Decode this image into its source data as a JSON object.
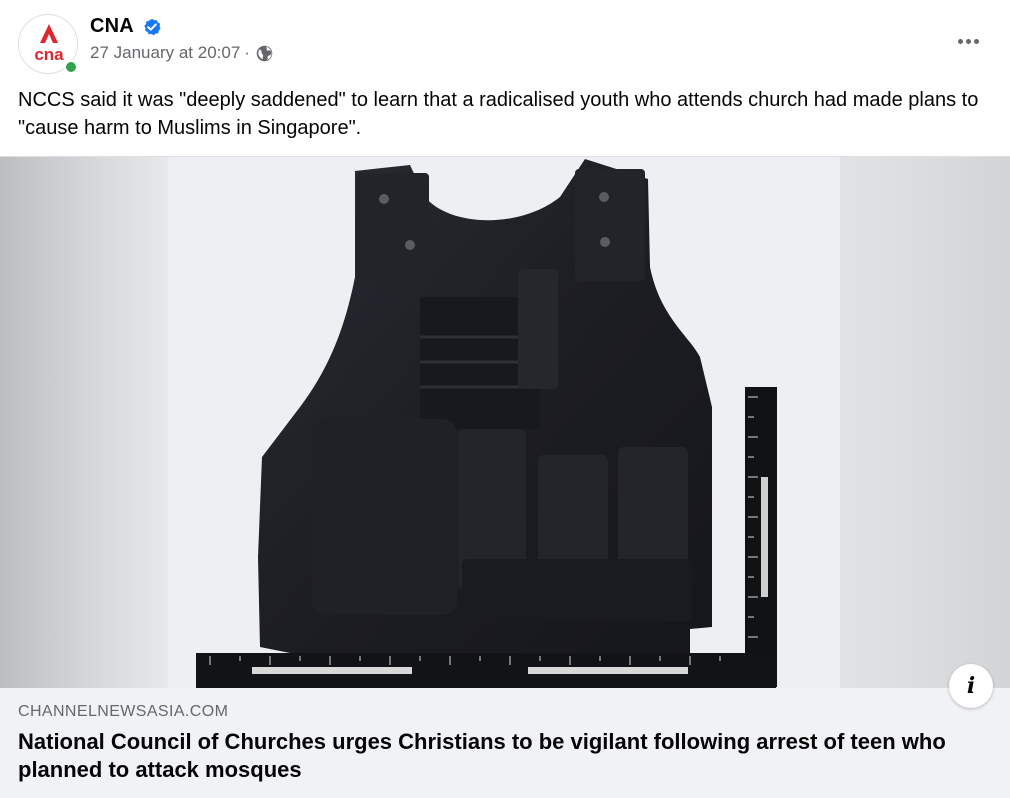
{
  "post": {
    "page_name": "CNA",
    "avatar_text": "cna",
    "timestamp": "27 January at 20:07",
    "meta_separator": "·",
    "caption": "NCCS said it was \"deeply saddened\" to learn that a radicalised youth who attends church had made plans to \"cause harm to Muslims in Singapore\".",
    "icons": {
      "verified": "verified-badge-icon",
      "audience": "globe-icon",
      "more": "more-options-icon",
      "info": "info-icon"
    },
    "colors": {
      "brand_red": "#e4242c",
      "verified_blue": "#1877f2",
      "online_green": "#31a24c",
      "secondary_text": "#65676b"
    }
  },
  "link_preview": {
    "domain": "CHANNELNEWSASIA.COM",
    "title": "National Council of Churches urges Christians to be vigilant following arrest of teen who planned to attack mosques"
  },
  "info_label": "i"
}
